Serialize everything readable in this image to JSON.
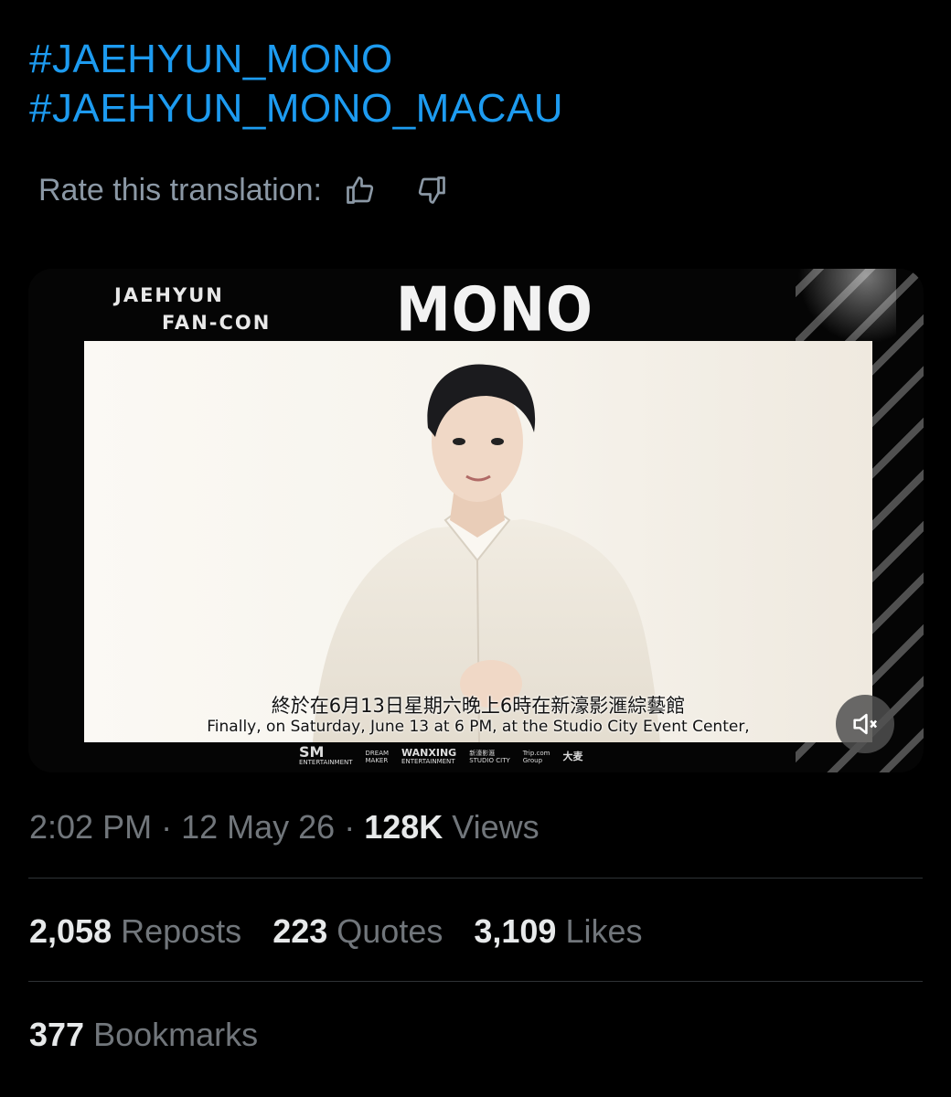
{
  "tweet": {
    "hashtags": [
      "#JAEHYUN_MONO",
      "#JAEHYUN_MONO_MACAU"
    ],
    "rate_label": "Rate this translation:",
    "icons": [
      "thumbs-up-icon",
      "thumbs-down-icon",
      "mute-icon"
    ]
  },
  "media": {
    "brand_line1": "JAEHYUN",
    "brand_line2": "FAN-CON",
    "title": "MONO",
    "subtitle_zh": "終於在6月13日星期六晚上6時在新濠影滙綜藝館",
    "subtitle_en": "Finally, on Saturday, June 13 at 6 PM, at the Studio City Event Center,",
    "sponsors": {
      "sm": "SM",
      "sm_sub": "ENTERTAINMENT",
      "dream1": "DREAM",
      "dream2": "MAKER",
      "wanxing": "WANXING",
      "wanxing_sub": "ENTERTAINMENT",
      "studio_zh": "新濠影滙",
      "studio_en": "STUDIO CITY",
      "trip": "Trip.com",
      "trip_sub": "Group",
      "damai": "大麦"
    }
  },
  "meta": {
    "time": "2:02 PM",
    "sep1": "·",
    "date": "12 May 26",
    "sep2": "·",
    "views_count": "128K",
    "views_label": "Views"
  },
  "stats": {
    "reposts_count": "2,058",
    "reposts_label": "Reposts",
    "quotes_count": "223",
    "quotes_label": "Quotes",
    "likes_count": "3,109",
    "likes_label": "Likes",
    "bookmarks_count": "377",
    "bookmarks_label": "Bookmarks"
  },
  "colors": {
    "link": "#1d9bf0",
    "muted": "#71767b",
    "text": "#e7e9ea",
    "background": "#000000",
    "divider": "#2f3336"
  }
}
